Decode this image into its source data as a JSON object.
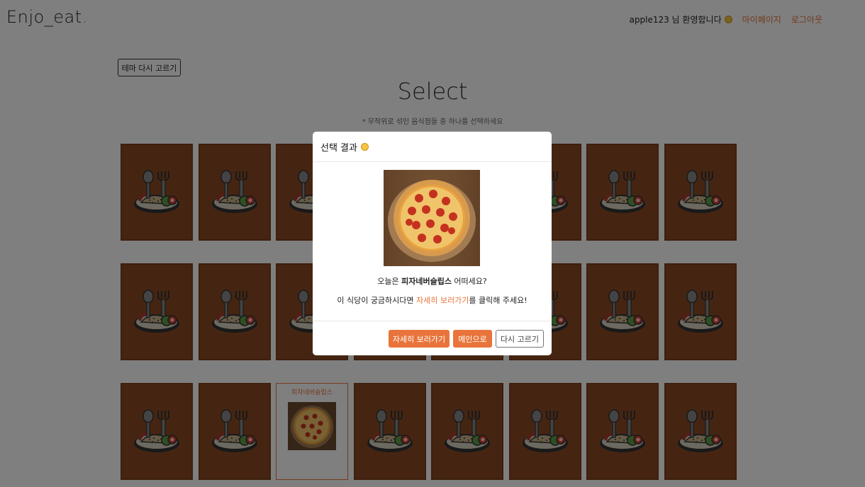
{
  "header": {
    "logo_text": "Enjo_eat",
    "logo_dot": ".",
    "greeting": "apple123 님 환영합니다",
    "links": [
      "마이페이지",
      "로그아웃"
    ]
  },
  "controls": {
    "theme_button": "테마 다시 고르기"
  },
  "main": {
    "title": "Select",
    "subtitle": "* 무작위로 섞인 음식점들 중 하나를 선택하세요"
  },
  "grid": {
    "rows": 3,
    "columns": 8,
    "revealed_card": {
      "row": 3,
      "column": 3,
      "name": "피자네버슬립스"
    }
  },
  "modal": {
    "title": "선택 결과",
    "line1_prefix": "오늘은 ",
    "restaurant_name": "피자네버슬립스",
    "line1_suffix": " 어떠세요?",
    "line2_prefix": "이 식당이 궁금하시다면 ",
    "line2_highlight": "자세히 보러가기",
    "line2_suffix": "를 클릭해 주세요!",
    "buttons": {
      "detail": "자세히 보러가기",
      "main": "메인으로",
      "retry": "다시 고르기"
    }
  },
  "colors": {
    "accent": "#e8743b",
    "card_back": "#8b4a24",
    "overlay": "rgba(0,0,0,0.5)"
  },
  "icons": {
    "card_back": "food-plate-icon",
    "emoji": "smile-emoji-icon",
    "food_image": "pizza-image"
  }
}
